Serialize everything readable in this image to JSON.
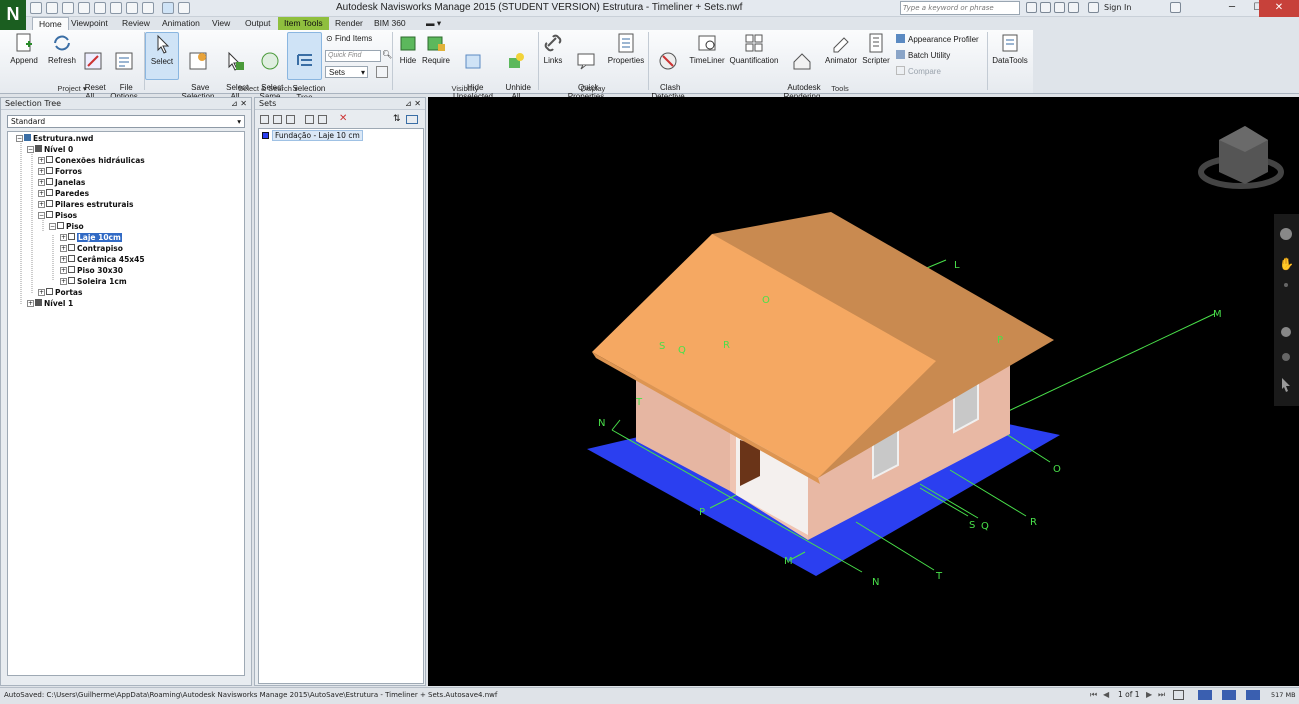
{
  "app": {
    "logo": "N",
    "title": "Autodesk Navisworks Manage 2015 (STUDENT VERSION)    Estrutura - Timeliner + Sets.nwf"
  },
  "header": {
    "search_placeholder": "Type a keyword or phrase",
    "signin": "Sign In",
    "min": "─",
    "max": "☐",
    "close": "✕"
  },
  "tabs": [
    "Home",
    "Viewpoint",
    "Review",
    "Animation",
    "View",
    "Output",
    "Item Tools",
    "Render",
    "BIM 360"
  ],
  "ribbon": {
    "project": {
      "append": "Append",
      "refresh": "Refresh",
      "reset": "Reset\nAll...",
      "file_options": "File\nOptions",
      "title": "Project ▾"
    },
    "select": {
      "select": "Select",
      "save_selection": "Save\nSelection",
      "select_all": "Select\nAll",
      "select_same": "Select\nSame",
      "selection_tree": "Selection\nTree",
      "find_items": "Find Items",
      "quick_find": "Quick Find",
      "sets": "Sets",
      "title": "Select & Search ▾"
    },
    "visibility": {
      "hide": "Hide",
      "require": "Require",
      "hide_unselected": "Hide\nUnselected",
      "unhide_all": "Unhide\nAll",
      "title": "Visibility"
    },
    "display": {
      "links": "Links",
      "quick_properties": "Quick\nProperties",
      "properties": "Properties",
      "title": "Display"
    },
    "tools": {
      "clash": "Clash\nDetective",
      "timeliner": "TimeLiner",
      "quantification": "Quantification",
      "rendering": "Autodesk\nRendering",
      "animator": "Animator",
      "scripter": "Scripter",
      "appearance_profiler": "Appearance Profiler",
      "batch_utility": "Batch Utility",
      "compare": "Compare",
      "title": "Tools"
    },
    "datatools": {
      "label": "DataTools"
    }
  },
  "selection_tree": {
    "title": "Selection Tree",
    "dropdown": "Standard",
    "items": [
      "Estrutura.nwd",
      "Nível 0",
      "Conexões hidráulicas",
      "Forros",
      "Janelas",
      "Paredes",
      "Pilares estruturais",
      "Pisos",
      "Piso",
      "Laje 10cm",
      "Contrapiso",
      "Cerâmica 45x45",
      "Piso 30x30",
      "Soleira 1cm",
      "Portas",
      "Nível 1"
    ]
  },
  "sets": {
    "title": "Sets",
    "items": [
      "Fundação - Laje 10 cm"
    ]
  },
  "viewport": {
    "labels": [
      "L",
      "O",
      "S",
      "Q",
      "R",
      "P",
      "M",
      "T",
      "N",
      "O",
      "R",
      "S",
      "Q",
      "P",
      "M",
      "N",
      "T"
    ]
  },
  "status": {
    "text": "AutoSaved: C:\\Users\\Guilherme\\AppData\\Roaming\\Autodesk Navisworks Manage 2015\\AutoSave\\Estrutura - Timeliner + Sets.Autosave4.nwf",
    "page": "1 of 1",
    "memory": "517 MB"
  },
  "colors": {
    "roof": "#f5a862",
    "roof_side": "#c88a4d",
    "walls": "#e8b8a4",
    "slab": "#2b3ff0",
    "gridlines": "#49e04a",
    "selection": "#316ac5",
    "logo": "#1b5e20"
  }
}
